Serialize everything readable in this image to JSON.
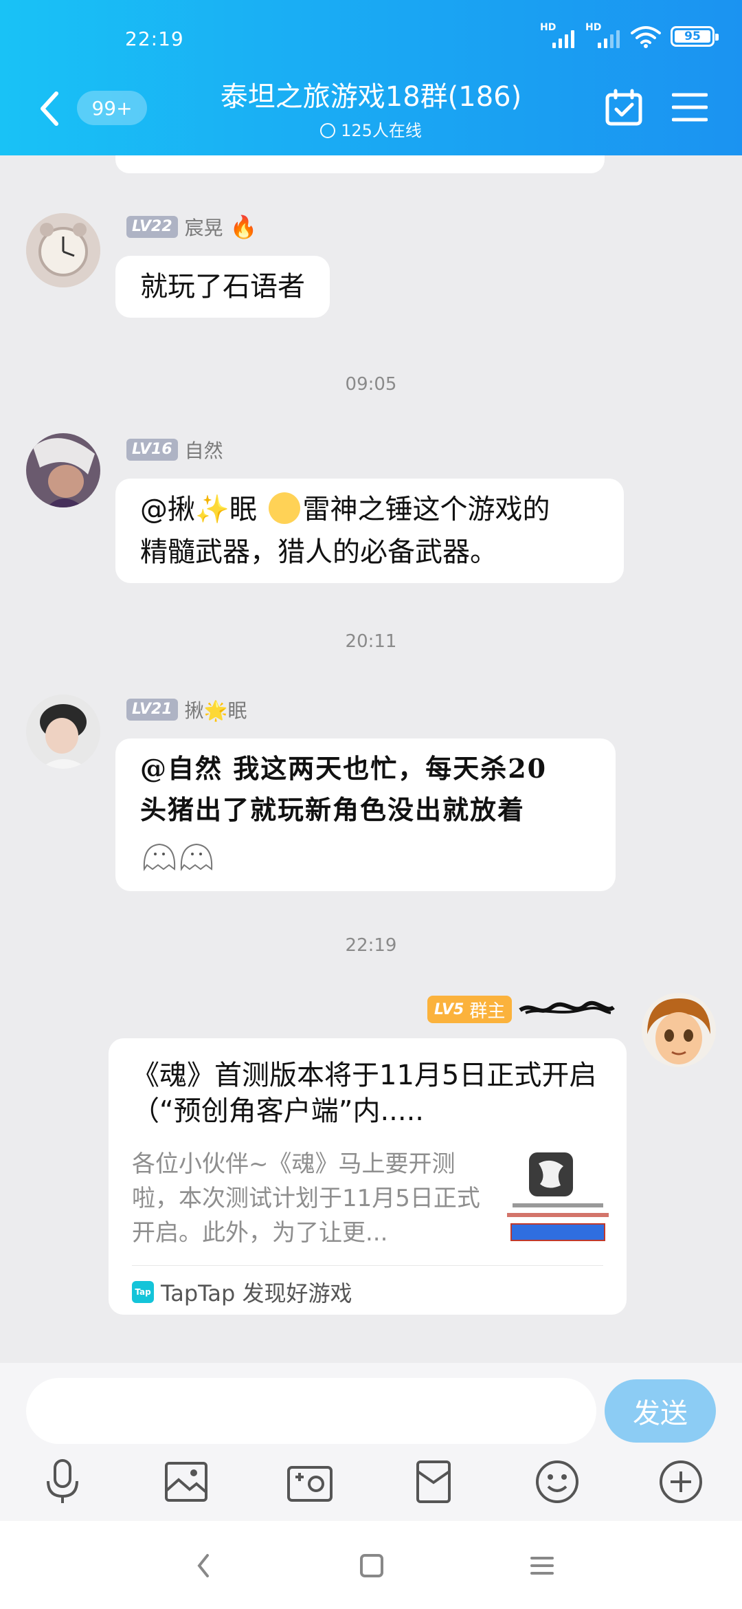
{
  "status_bar": {
    "time": "22:19",
    "hd1": "HD",
    "hd2": "HD",
    "battery": "95"
  },
  "header": {
    "unread_badge": "99+",
    "title": "泰坦之旅游戏18群(186)",
    "online_status": "125人在线"
  },
  "messages": [
    {
      "level": "LV22",
      "sender": "宸晃",
      "text": "就玩了石语者"
    },
    {
      "time": "09:05"
    },
    {
      "level": "LV16",
      "sender": "自然",
      "text_part1": "@揪",
      "text_part2": "眠",
      "text_part3": "雷神之锤这个游戏的",
      "text_line2": "精髓武器，猎人的必备武器。"
    },
    {
      "time": "20:11"
    },
    {
      "level": "LV21",
      "sender_part1": "揪",
      "sender_part2": "眠",
      "text_line1": "@自然 我这两天也忙，每天杀20",
      "text_line2": "头猪出了就玩新角色没出就放着"
    },
    {
      "time": "22:19"
    },
    {
      "level": "LV5",
      "role": "群主",
      "card": {
        "title": "《魂》首测版本将于11月5日正式开启（“预创角客户端”内.....",
        "description": "各位小伙伴~《魂》马上要开测啦，本次测试计划于11月5日正式开启。此外，为了让更...",
        "source_icon": "Tap",
        "source": "TapTap 发现好游戏"
      }
    }
  ],
  "input": {
    "placeholder": "",
    "send_label": "发送"
  },
  "toolbar": {
    "icons": [
      "microphone-icon",
      "image-icon",
      "camera-icon",
      "red-packet-icon",
      "emoji-icon",
      "plus-icon"
    ]
  }
}
